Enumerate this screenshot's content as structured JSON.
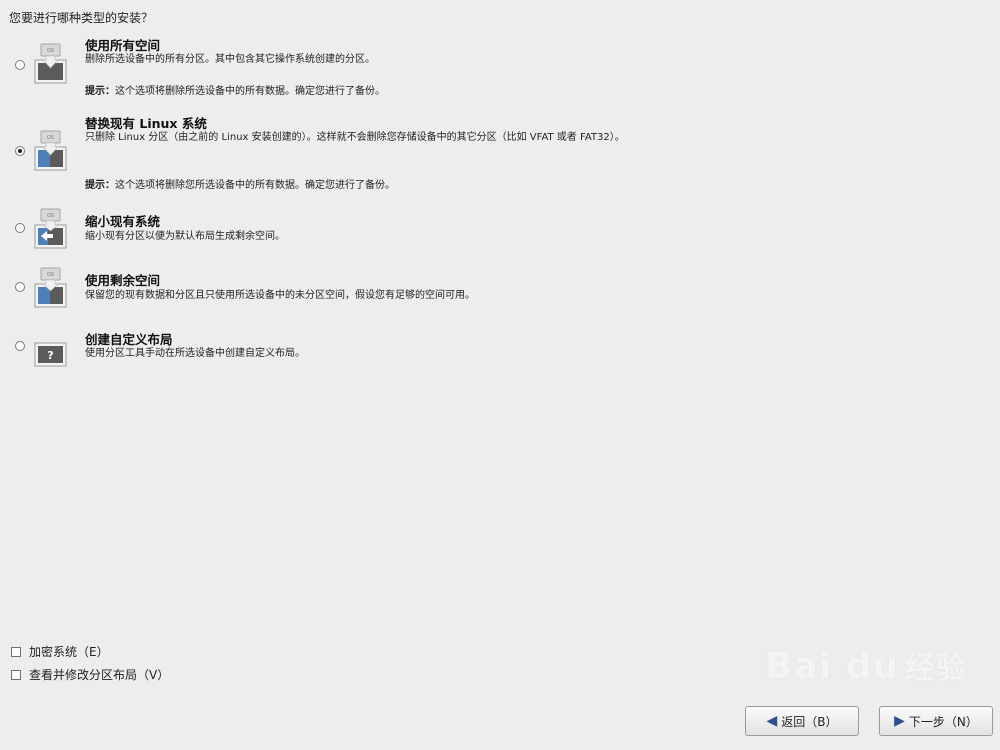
{
  "question": "您要进行哪种类型的安装？",
  "options": [
    {
      "title": "使用所有空间",
      "desc": "删除所选设备中的所有分区。其中包含其它操作系统创建的分区。",
      "hint_label": "提示：",
      "hint": "这个选项将删除所选设备中的所有数据。确定您进行了备份。",
      "selected": false,
      "icon": "use-all-space-icon"
    },
    {
      "title": "替换现有 Linux 系统",
      "desc": "只删除 Linux 分区（由之前的 Linux 安装创建的）。这样就不会删除您存储设备中的其它分区（比如 VFAT 或者 FAT32）。",
      "hint_label": "提示：",
      "hint": "这个选项将删除您所选设备中的所有数据。确定您进行了备份。",
      "selected": true,
      "icon": "replace-linux-icon"
    },
    {
      "title": "缩小现有系统",
      "desc": "缩小现有分区以便为默认布局生成剩余空间。",
      "selected": false,
      "icon": "shrink-system-icon"
    },
    {
      "title": "使用剩余空间",
      "desc": "保留您的现有数据和分区且只使用所选设备中的未分区空间，假设您有足够的空间可用。",
      "selected": false,
      "icon": "use-free-space-icon"
    },
    {
      "title": "创建自定义布局",
      "desc": "使用分区工具手动在所选设备中创建自定义布局。",
      "selected": false,
      "icon": "custom-layout-icon"
    }
  ],
  "checkboxes": {
    "encrypt": "加密系统（E）",
    "review": "查看并修改分区布局（V）"
  },
  "buttons": {
    "back": "返回（B）",
    "next": "下一步（N）"
  },
  "watermark": {
    "brand": "Bai du",
    "suffix": "经验"
  },
  "colors": {
    "background": "#ededed",
    "icon_blue": "#4f7fb8",
    "icon_dark": "#5b5b5b"
  }
}
